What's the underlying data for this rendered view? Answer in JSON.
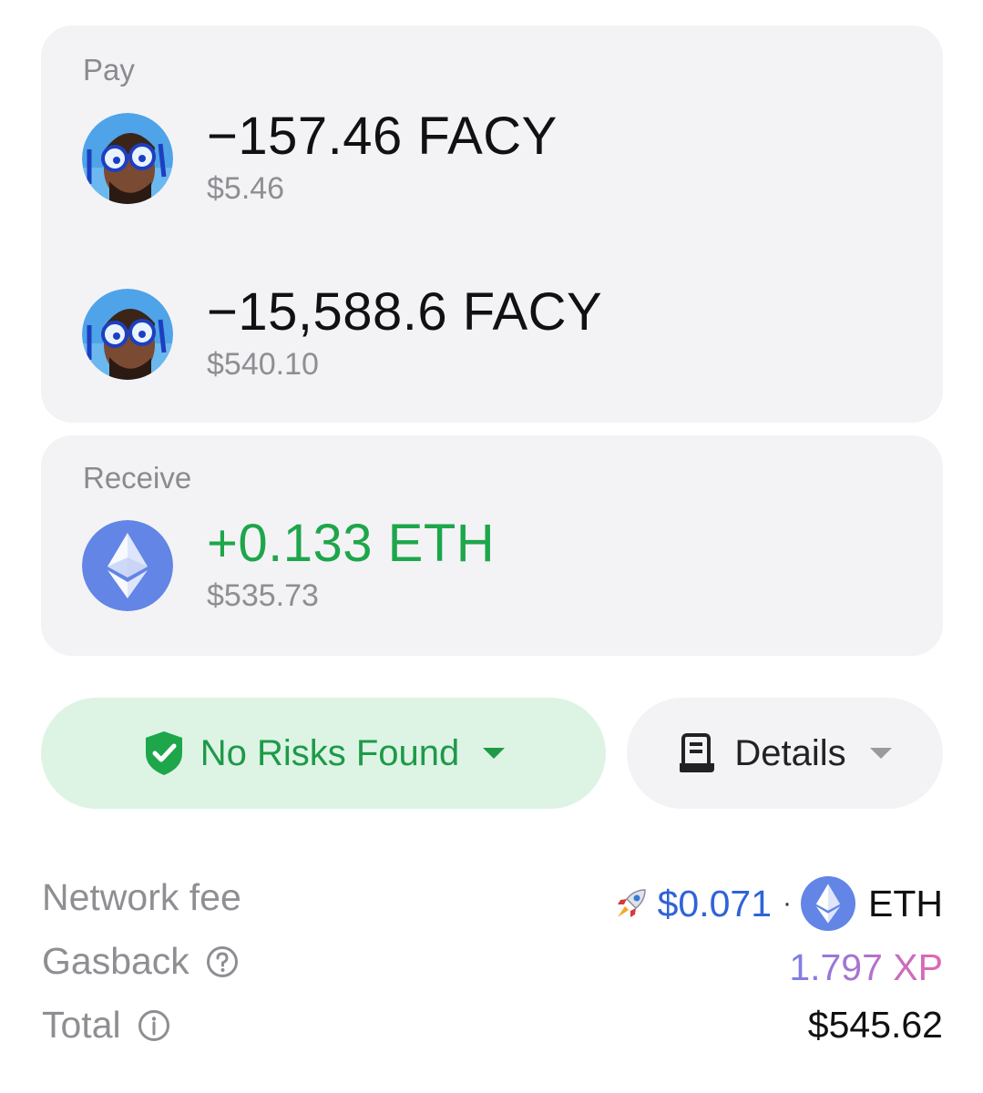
{
  "pay": {
    "label": "Pay",
    "items": [
      {
        "amount": "−157.46 FACY",
        "usd": "$5.46",
        "icon": "facy-token-avatar"
      },
      {
        "amount": "−15,588.6 FACY",
        "usd": "$540.10",
        "icon": "facy-token-avatar"
      }
    ]
  },
  "receive": {
    "label": "Receive",
    "item": {
      "amount": "+0.133 ETH",
      "usd": "$535.73",
      "icon": "eth-token-icon"
    }
  },
  "risk_button": {
    "label": "No Risks Found",
    "icon": "shield-check-icon",
    "color": "#1e9a48"
  },
  "details_button": {
    "label": "Details",
    "icon": "receipt-icon"
  },
  "summary": {
    "network_fee": {
      "label": "Network fee",
      "value": "$0.071",
      "separator": "·",
      "token": "ETH",
      "icon": "rocket-icon",
      "value_color": "#2f63d8"
    },
    "gasback": {
      "label": "Gasback",
      "value": "1.797 XP",
      "icon": "question-icon"
    },
    "total": {
      "label": "Total",
      "value": "$545.62",
      "icon": "info-icon"
    }
  }
}
